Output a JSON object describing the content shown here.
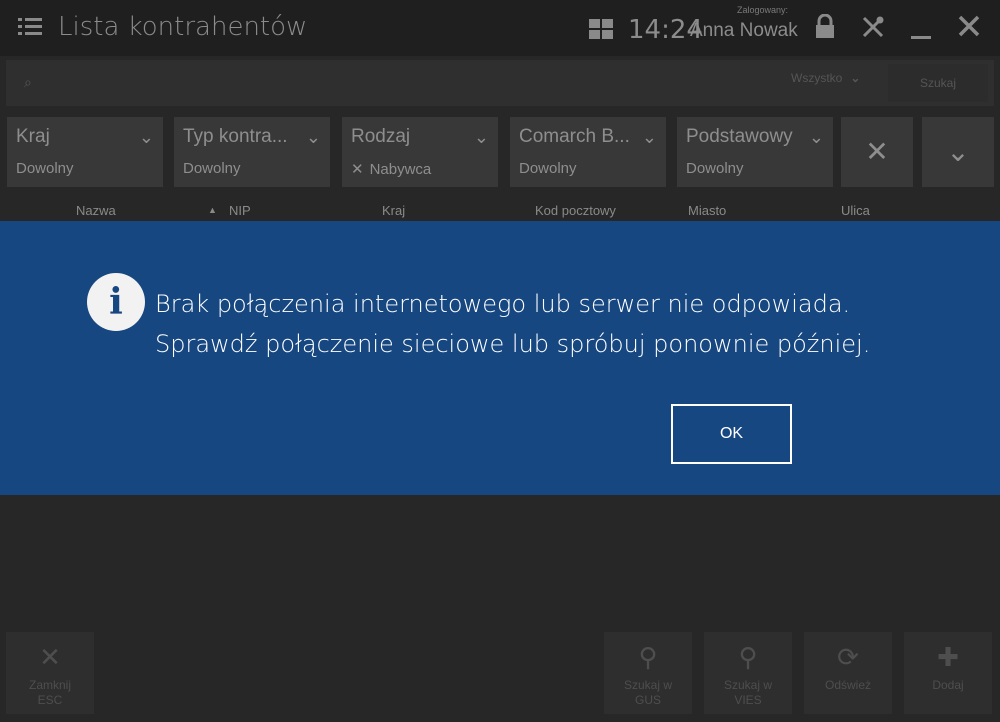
{
  "header": {
    "title": "Lista kontrahentów",
    "clock": "14:24",
    "logged_label": "Zalogowany:",
    "user_name": "Anna Nowak"
  },
  "search": {
    "placeholder": "",
    "filter_value": "Wszystko",
    "button_label": "Szukaj"
  },
  "filters": [
    {
      "title": "Kraj",
      "value": "Dowolny"
    },
    {
      "title": "Typ kontra...",
      "value": "Dowolny"
    },
    {
      "title": "Rodzaj",
      "value": "Nabywca",
      "has_clear": true
    },
    {
      "title": "Comarch B...",
      "value": "Dowolny"
    },
    {
      "title": "Podstawowy",
      "value": "Dowolny"
    }
  ],
  "columns": [
    "Nazwa",
    "NIP",
    "Kraj",
    "Kod pocztowy",
    "Miasto",
    "Ulica"
  ],
  "dialog": {
    "line1": "Brak połączenia internetowego lub serwer nie odpowiada.",
    "line2": "Sprawdź połączenie sieciowe lub spróbuj ponownie później.",
    "ok_label": "OK",
    "icon": "info-icon"
  },
  "toolbar": {
    "close": {
      "line1": "Zamknij",
      "line2": "ESC"
    },
    "search_gus": {
      "line1": "Szukaj w",
      "line2": "GUS"
    },
    "search_vies": {
      "line1": "Szukaj w",
      "line2": "VIES"
    },
    "refresh": {
      "line1": "Odśwież"
    },
    "add": {
      "line1": "Dodaj"
    }
  },
  "colors": {
    "dialog_bg": "#174781",
    "page_bg": "#272727"
  }
}
